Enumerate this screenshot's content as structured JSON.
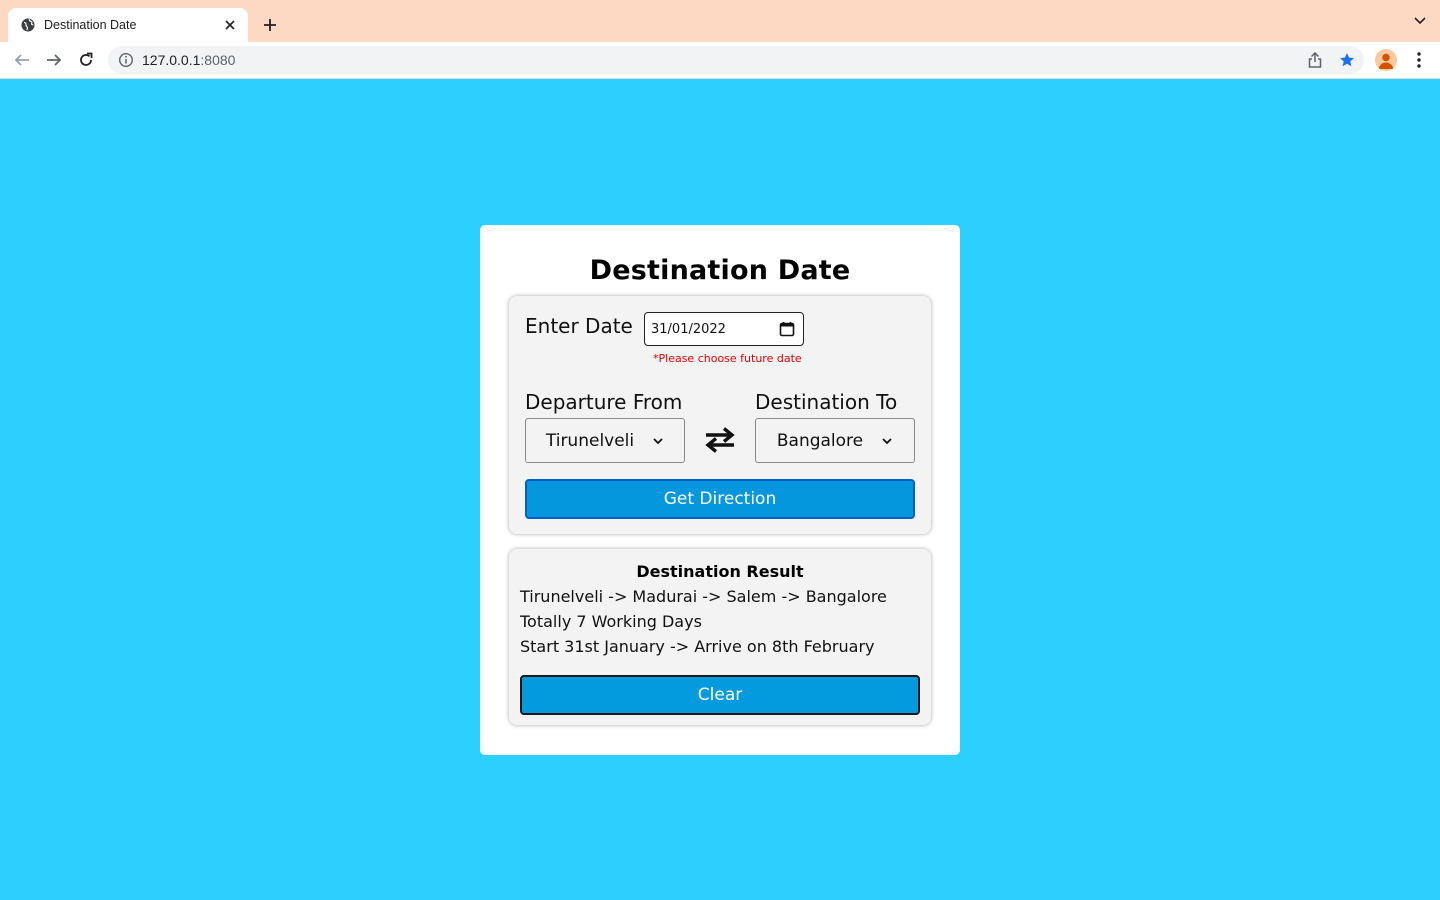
{
  "browser": {
    "tab_title": "Destination Date",
    "url_host": "127.0.0.1",
    "url_port": ":8080"
  },
  "page": {
    "title": "Destination Date",
    "form": {
      "date_label": "Enter Date",
      "date_value": "31/01/2022",
      "date_hint": "*Please choose future date",
      "from_label": "Departure From",
      "from_value": "Tirunelveli",
      "to_label": "Destination To",
      "to_value": "Bangalore",
      "submit_label": "Get Direction"
    },
    "result": {
      "title": "Destination Result",
      "route": "Tirunelveli -> Madurai -> Salem -> Bangalore",
      "duration": "Totally 7 Working Days",
      "schedule": "Start 31st January -> Arrive on 8th February",
      "clear_label": "Clear"
    }
  },
  "colors": {
    "page_background": "#2bd0ff",
    "tab_strip": "#fdd9c4",
    "primary_button": "#0597dd",
    "hint_text": "#e00000",
    "bookmark_star": "#1a73e8"
  },
  "icons": [
    "globe-icon",
    "close-icon",
    "plus-icon",
    "chevron-down-icon",
    "back-arrow-icon",
    "forward-arrow-icon",
    "reload-icon",
    "info-icon",
    "share-icon",
    "star-icon",
    "profile-icon",
    "more-vert-icon",
    "calendar-icon",
    "swap-arrows-icon"
  ]
}
